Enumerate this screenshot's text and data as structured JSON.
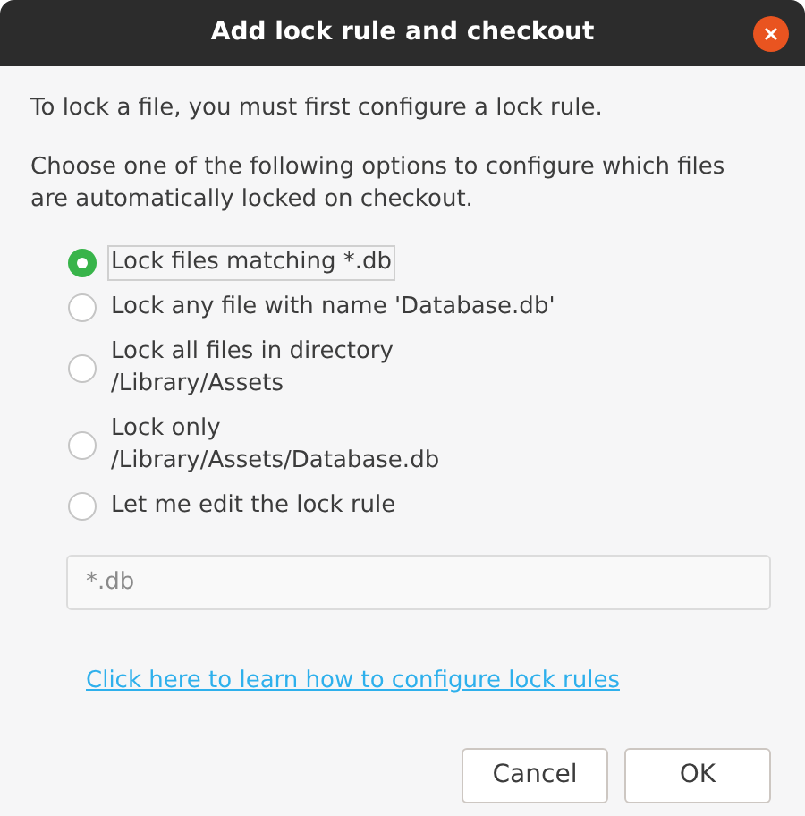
{
  "window": {
    "title": "Add lock rule and checkout"
  },
  "intro": "To lock a file, you must first configure a lock rule.",
  "instructions": "Choose one of the following options to configure which files are automatically locked on checkout.",
  "options": [
    {
      "label": "Lock files matching *.db",
      "selected": true
    },
    {
      "label": "Lock any file with name 'Database.db'",
      "selected": false
    },
    {
      "label": "Lock all files in directory\n/Library/Assets",
      "selected": false
    },
    {
      "label": "Lock only\n/Library/Assets/Database.db",
      "selected": false
    },
    {
      "label": "Let me edit the lock rule",
      "selected": false
    }
  ],
  "rule_field": {
    "value": "*.db",
    "disabled": true
  },
  "help_link": "Click here to learn how to configure lock rules",
  "buttons": [
    "Cancel",
    "OK"
  ]
}
